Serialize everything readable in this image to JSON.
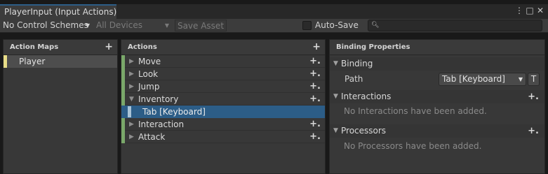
{
  "window": {
    "title": "PlayerInput (Input Actions)",
    "buttons": [
      "⋮",
      "□",
      "✕"
    ]
  },
  "toolbar": {
    "control_schemes": "No Control Schemes",
    "devices": "All Devices",
    "save_asset": "Save Asset",
    "auto_save": "Auto-Save",
    "auto_save_checked": false,
    "search_placeholder": ""
  },
  "action_maps": {
    "header": "Action Maps",
    "add": "+",
    "items": [
      {
        "label": "Player",
        "selected": true
      }
    ]
  },
  "actions": {
    "header": "Actions",
    "add": "+",
    "items": [
      {
        "label": "Move",
        "expanded": false
      },
      {
        "label": "Look",
        "expanded": false
      },
      {
        "label": "Jump",
        "expanded": false
      },
      {
        "label": "Inventory",
        "expanded": true,
        "bindings": [
          {
            "label": "Tab [Keyboard]",
            "selected": true
          }
        ]
      },
      {
        "label": "Interaction",
        "expanded": false
      },
      {
        "label": "Attack",
        "expanded": false
      }
    ],
    "add_binding_symbol": "+."
  },
  "properties": {
    "header": "Binding Properties",
    "binding": {
      "label": "Binding",
      "path_label": "Path",
      "path_value": "Tab [Keyboard]",
      "t_button": "T"
    },
    "interactions": {
      "label": "Interactions",
      "empty": "No Interactions have been added."
    },
    "processors": {
      "label": "Processors",
      "empty": "No Processors have been added."
    }
  },
  "colors": {
    "selection": "#2c5d87",
    "map_marker": "#e8dd88",
    "action_marker": "#7aa86a",
    "binding_marker": "#a9c3d6"
  }
}
